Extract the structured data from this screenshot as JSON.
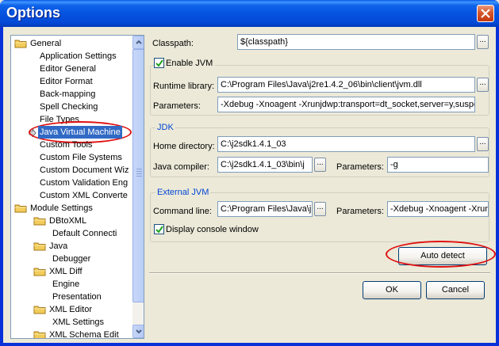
{
  "window": {
    "title": "Options"
  },
  "tree": {
    "items": [
      {
        "label": "General",
        "level": 0,
        "folder": true
      },
      {
        "label": "Application Settings",
        "level": 1
      },
      {
        "label": "Editor General",
        "level": 1
      },
      {
        "label": "Editor Format",
        "level": 1
      },
      {
        "label": "Back-mapping",
        "level": 1
      },
      {
        "label": "Spell Checking",
        "level": 1
      },
      {
        "label": "File Types",
        "level": 1
      },
      {
        "label": "Java Virtual Machine",
        "level": 1,
        "selected": true
      },
      {
        "label": "Custom Tools",
        "level": 1
      },
      {
        "label": "Custom File Systems",
        "level": 1
      },
      {
        "label": "Custom Document Wiz",
        "level": 1
      },
      {
        "label": "Custom Validation Eng",
        "level": 1
      },
      {
        "label": "Custom XML Converte",
        "level": 1
      },
      {
        "label": "Module Settings",
        "level": 0,
        "folder": true
      },
      {
        "label": "DBtoXML",
        "level": 1,
        "folder": true
      },
      {
        "label": "Default Connecti",
        "level": 2
      },
      {
        "label": "Java",
        "level": 1,
        "folder": true
      },
      {
        "label": "Debugger",
        "level": 2
      },
      {
        "label": "XML Diff",
        "level": 1,
        "folder": true
      },
      {
        "label": "Engine",
        "level": 2
      },
      {
        "label": "Presentation",
        "level": 2
      },
      {
        "label": "XML Editor",
        "level": 1,
        "folder": true
      },
      {
        "label": "XML Settings",
        "level": 2
      },
      {
        "label": "XML Schema Edit",
        "level": 1,
        "folder": true
      }
    ]
  },
  "form": {
    "classpath_label": "Classpath:",
    "classpath_value": "${classpath}",
    "enable_jvm_label": "Enable JVM",
    "runtime_label": "Runtime library:",
    "runtime_value": "C:\\Program Files\\Java\\j2re1.4.2_06\\bin\\client\\jvm.dll",
    "params_label": "Parameters:",
    "params_value": "-Xdebug -Xnoagent -Xrunjdwp:transport=dt_socket,server=y,suspe",
    "jdk_group": "JDK",
    "home_label": "Home directory:",
    "home_value": "C:\\j2sdk1.4.1_03",
    "compiler_label": "Java compiler:",
    "compiler_value": "C:\\j2sdk1.4.1_03\\bin\\j",
    "jdk_params_label": "Parameters:",
    "jdk_params_value": "-g",
    "ext_group": "External JVM",
    "cmd_label": "Command line:",
    "cmd_value": "C:\\Program Files\\Java\\j",
    "ext_params_label": "Parameters:",
    "ext_params_value": "-Xdebug -Xnoagent -Xrunj",
    "console_label": "Display console window",
    "auto_detect": "Auto detect",
    "ellipsis": "..."
  },
  "buttons": {
    "ok": "OK",
    "cancel": "Cancel"
  },
  "colors": {
    "title_bar": "#0553e0",
    "selection": "#316ac5",
    "highlight_ring": "#e01010",
    "group_label": "#0046d5"
  }
}
